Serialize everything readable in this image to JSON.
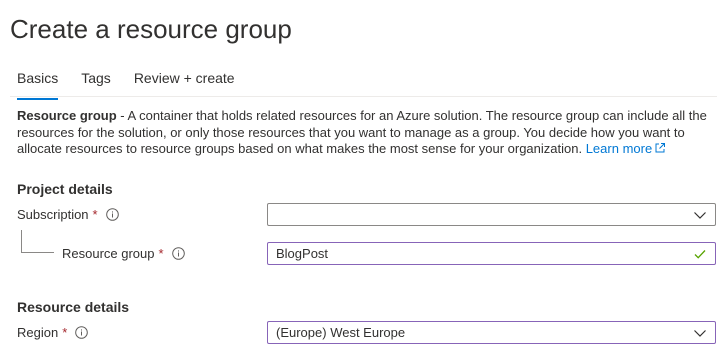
{
  "page": {
    "title": "Create a resource group"
  },
  "tabs": [
    {
      "label": "Basics",
      "active": true
    },
    {
      "label": "Tags",
      "active": false
    },
    {
      "label": "Review + create",
      "active": false
    }
  ],
  "description": {
    "term": "Resource group",
    "text": " - A container that holds related resources for an Azure solution. The resource group can include all the resources for the solution, or only those resources that you want to manage as a group. You decide how you want to allocate resources to resource groups based on what makes the most sense for your organization. ",
    "link_label": "Learn more"
  },
  "project_details": {
    "heading": "Project details",
    "subscription": {
      "label": "Subscription",
      "required_mark": "*",
      "value": ""
    },
    "resource_group": {
      "label": "Resource group",
      "required_mark": "*",
      "value": "BlogPost",
      "valid": true
    }
  },
  "resource_details": {
    "heading": "Resource details",
    "region": {
      "label": "Region",
      "required_mark": "*",
      "value": "(Europe) West Europe"
    }
  },
  "colors": {
    "accent": "#0078d4",
    "valid_border": "#8764b8",
    "valid_check": "#57a300",
    "required": "#a4262c"
  },
  "icons": {
    "info": "info-icon",
    "dropdown": "chevron-down-icon",
    "valid": "checkmark-icon",
    "external": "external-link-icon"
  }
}
